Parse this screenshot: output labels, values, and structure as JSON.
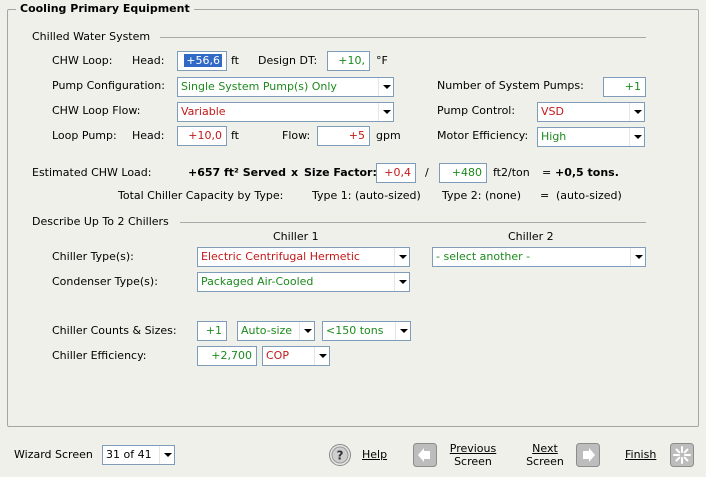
{
  "panel_title": "Cooling Primary Equipment",
  "chw": {
    "section_title": "Chilled Water System",
    "loop_label": "CHW Loop:",
    "head_label": "Head:",
    "head_value": "+56,6",
    "head_unit": "ft",
    "design_dt_label": "Design DT:",
    "design_dt_value": "+10,",
    "design_dt_unit": "°F",
    "pump_config_label": "Pump Configuration:",
    "pump_config_value": "Single System Pump(s) Only",
    "num_pumps_label": "Number of System Pumps:",
    "num_pumps_value": "+1",
    "loop_flow_label": "CHW Loop Flow:",
    "loop_flow_value": "Variable",
    "pump_control_label": "Pump Control:",
    "pump_control_value": "VSD",
    "loop_pump_label": "Loop Pump:",
    "loop_pump_head_label": "Head:",
    "loop_pump_head_value": "+10,0",
    "loop_pump_head_unit": "ft",
    "flow_label": "Flow:",
    "flow_value": "+5",
    "flow_unit": "gpm",
    "motor_eff_label": "Motor Efficiency:",
    "motor_eff_value": "High"
  },
  "load": {
    "label": "Estimated CHW Load:",
    "served": "+657 ft² Served",
    "times": "x",
    "size_factor_label": "Size Factor:",
    "size_factor_value": "+0,4",
    "slash": "/",
    "divisor_value": "+480",
    "divisor_unit": "ft2/ton",
    "equals": "=",
    "result": "+0,5 tons.",
    "total_label": "Total Chiller Capacity by Type:",
    "type1": "Type 1: (auto-sized)",
    "type2": "Type 2: (none)",
    "total_equals": "=",
    "total_value": "(auto-sized)"
  },
  "chillers": {
    "section_title": "Describe Up To 2 Chillers",
    "col1": "Chiller 1",
    "col2": "Chiller 2",
    "type_label": "Chiller Type(s):",
    "type1_value": "Electric Centrifugal Hermetic",
    "type2_value": "- select another -",
    "condenser_label": "Condenser Type(s):",
    "condenser_value": "Packaged Air-Cooled",
    "counts_label": "Chiller Counts & Sizes:",
    "count_value": "+1",
    "size_mode": "Auto-size",
    "size_range": "<150 tons",
    "eff_label": "Chiller Efficiency:",
    "eff_value": "+2,700",
    "eff_unit": "COP"
  },
  "footer": {
    "wizard_label": "Wizard Screen",
    "wizard_value": "31 of 41",
    "help": "Help",
    "prev_line1": "Previous",
    "prev_line2": "Screen",
    "next_line1": "Next",
    "next_line2": "Screen",
    "finish": "Finish"
  }
}
